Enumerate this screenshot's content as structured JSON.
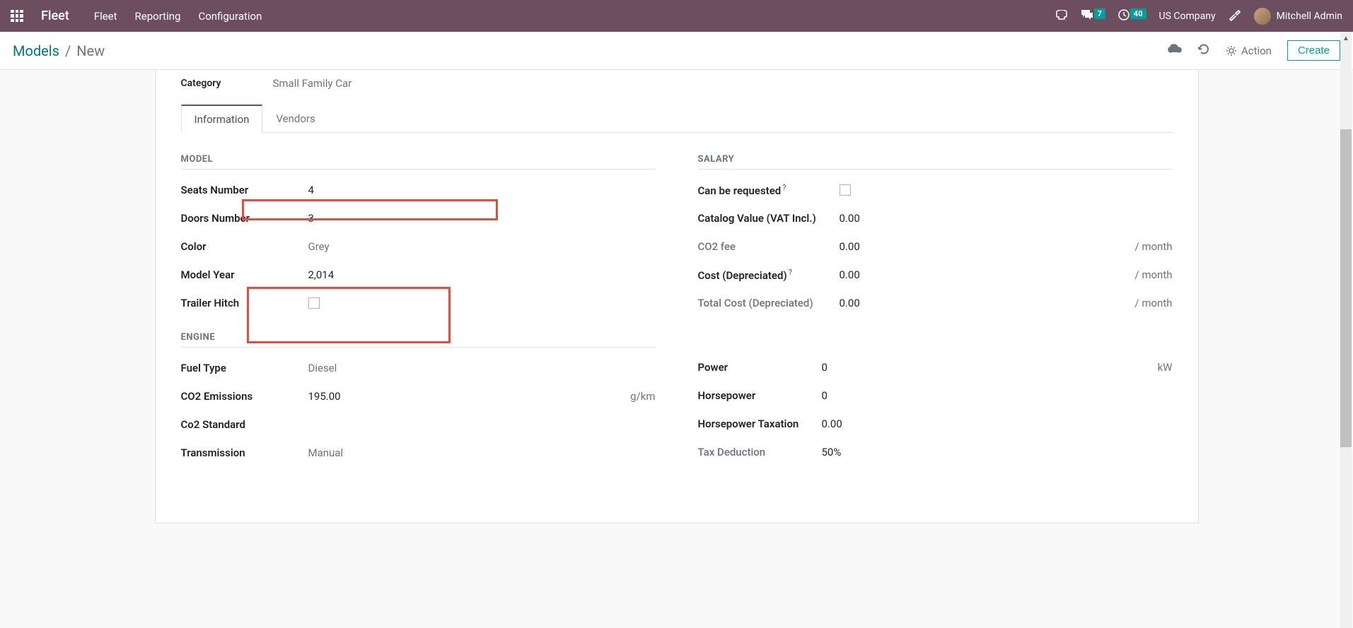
{
  "topbar": {
    "app_title": "Fleet",
    "menu": [
      "Fleet",
      "Reporting",
      "Configuration"
    ],
    "msg_badge": "7",
    "clock_badge": "40",
    "company": "US Company",
    "user": "Mitchell Admin"
  },
  "controlbar": {
    "breadcrumb_root": "Models",
    "breadcrumb_current": "New",
    "action_label": "Action",
    "create_label": "Create"
  },
  "category": {
    "label": "Category",
    "value": "Small Family Car"
  },
  "tabs": {
    "information": "Information",
    "vendors": "Vendors"
  },
  "sections": {
    "model": "MODEL",
    "engine": "ENGINE",
    "salary": "SALARY"
  },
  "model": {
    "seats_label": "Seats Number",
    "seats_value": "4",
    "doors_label": "Doors Number",
    "doors_value": "3",
    "color_label": "Color",
    "color_value": "Grey",
    "year_label": "Model Year",
    "year_value": "2,014",
    "trailer_label": "Trailer Hitch"
  },
  "engine": {
    "fuel_label": "Fuel Type",
    "fuel_value": "Diesel",
    "co2_label": "CO2 Emissions",
    "co2_value": "195.00",
    "co2_unit": "g/km",
    "co2std_label": "Co2 Standard",
    "trans_label": "Transmission",
    "trans_value": "Manual",
    "power_label": "Power",
    "power_value": "0",
    "power_unit": "kW",
    "hp_label": "Horsepower",
    "hp_value": "0",
    "hptax_label": "Horsepower Taxation",
    "hptax_value": "0.00",
    "taxded_label": "Tax Deduction",
    "taxded_value": "50%"
  },
  "salary": {
    "canreq_label": "Can be requested",
    "catalog_label": "Catalog Value (VAT Incl.)",
    "catalog_value": "0.00",
    "co2fee_label": "CO2 fee",
    "co2fee_value": "0.00",
    "co2fee_unit": "/ month",
    "costdep_label": "Cost (Depreciated)",
    "costdep_value": "0.00",
    "costdep_unit": "/ month",
    "total_label": "Total Cost (Depreciated)",
    "total_value": "0.00",
    "total_unit": "/ month"
  }
}
